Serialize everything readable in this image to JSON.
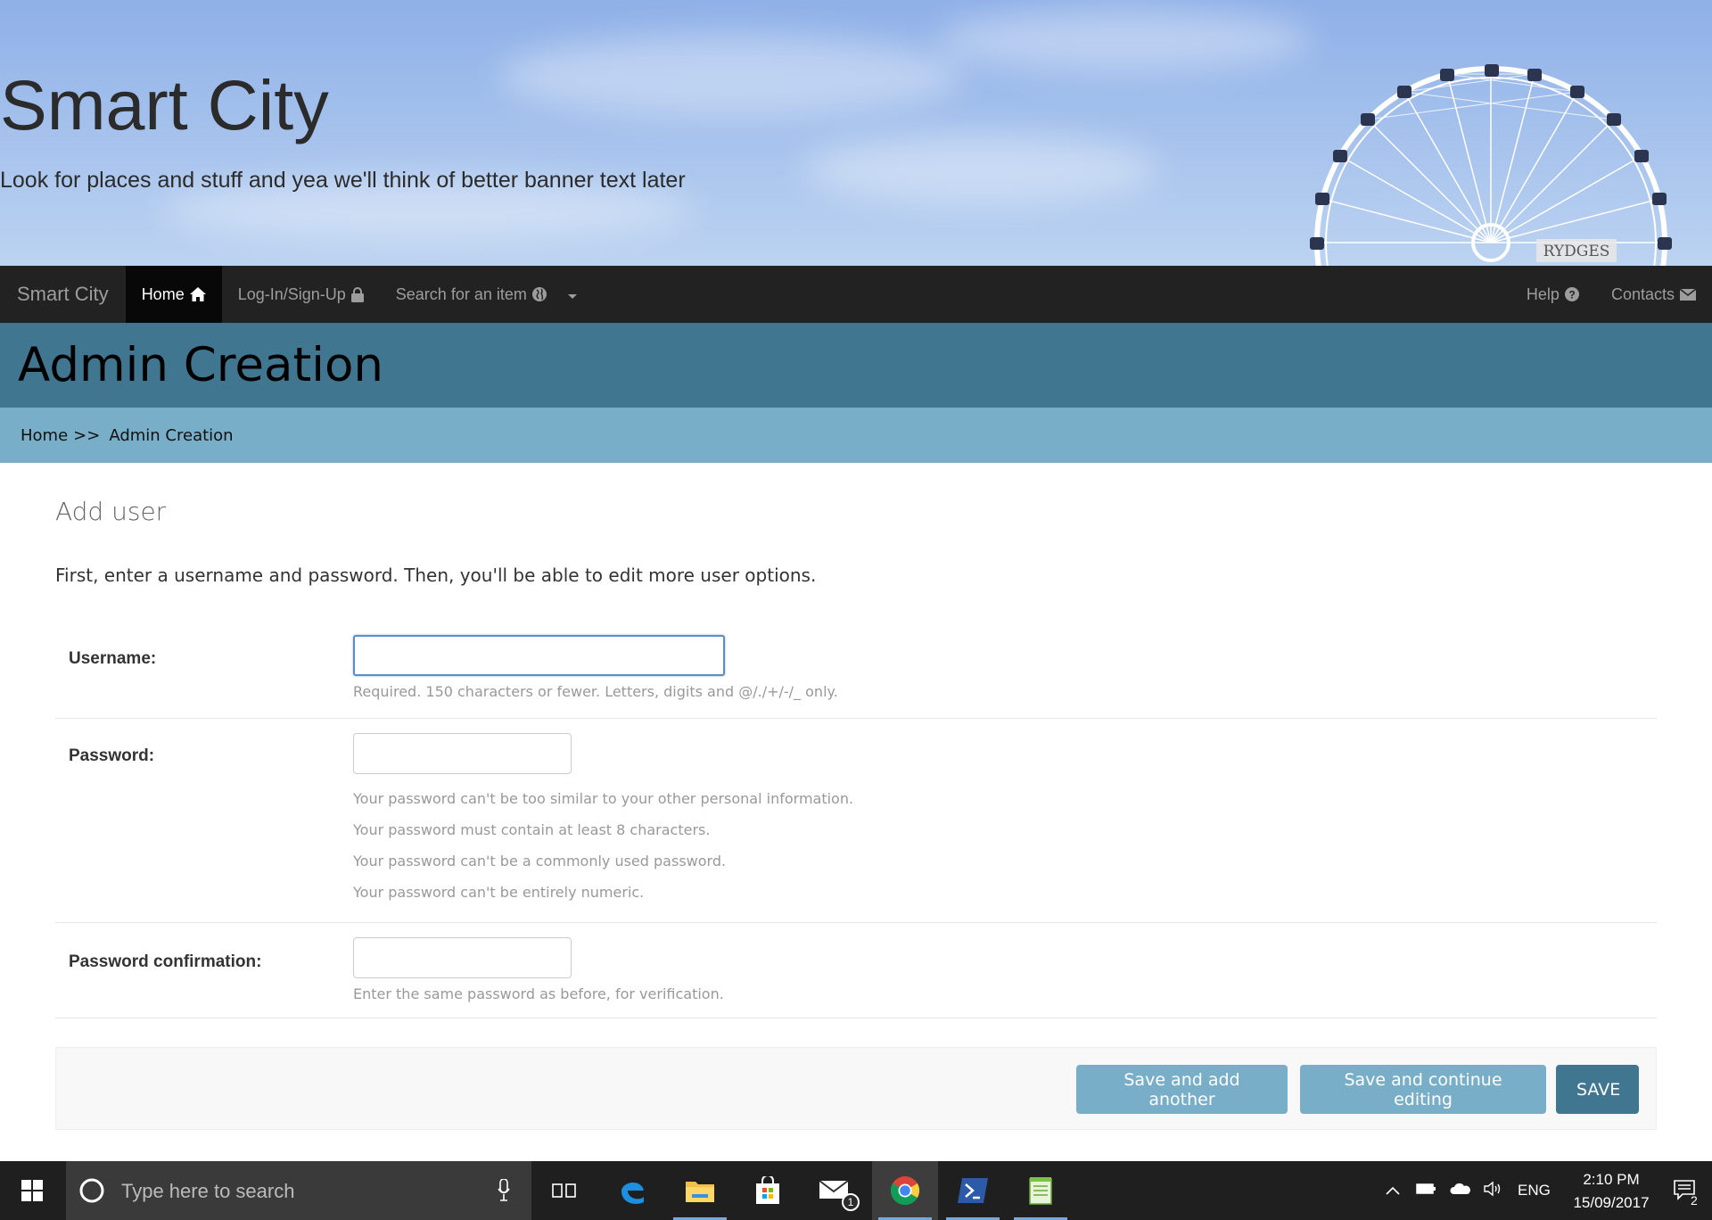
{
  "banner": {
    "title": "Smart City",
    "subtitle": "Look for places and stuff and yea we'll think of better banner text later",
    "wheel_sign": "RYDGES"
  },
  "navbar": {
    "brand": "Smart City",
    "items": [
      {
        "label": "Home",
        "icon": "home-icon",
        "active": true
      },
      {
        "label": "Log-In/Sign-Up",
        "icon": "lock-icon"
      },
      {
        "label": "Search for an item",
        "icon": "globe-icon",
        "dropdown": true
      }
    ],
    "right_items": [
      {
        "label": "Help",
        "icon": "question-circle-icon"
      },
      {
        "label": "Contacts",
        "icon": "envelope-icon"
      }
    ]
  },
  "page_header": {
    "title": "Admin Creation"
  },
  "breadcrumbs": {
    "home": "Home",
    "separator": ">>",
    "current": "Admin Creation"
  },
  "form": {
    "title": "Add user",
    "intro": "First, enter a username and password. Then, you'll be able to edit more user options.",
    "username": {
      "label": "Username:",
      "value": "",
      "help": "Required. 150 characters or fewer. Letters, digits and @/./+/-/_ only."
    },
    "password": {
      "label": "Password:",
      "value": "",
      "help": [
        "Your password can't be too similar to your other personal information.",
        "Your password must contain at least 8 characters.",
        "Your password can't be a commonly used password.",
        "Your password can't be entirely numeric."
      ]
    },
    "password_confirmation": {
      "label": "Password confirmation:",
      "value": "",
      "help": "Enter the same password as before, for verification."
    },
    "buttons": {
      "save_add_another": "Save and add another",
      "save_continue": "Save and continue editing",
      "save": "SAVE"
    }
  },
  "taskbar": {
    "search_placeholder": "Type here to search",
    "apps": [
      "task-view-icon",
      "edge-icon",
      "file-explorer-icon",
      "store-icon",
      "mail-icon",
      "chrome-icon",
      "powershell-icon",
      "notepad-icon"
    ],
    "mail_badge": "1",
    "language": "ENG",
    "time": "2:10 PM",
    "date": "15/09/2017",
    "notification_count": "2"
  },
  "colors": {
    "navbar_bg": "#222222",
    "header_bg": "#417690",
    "breadcrumb_bg": "#79aec8",
    "button_secondary": "#79aec8",
    "button_primary": "#417690"
  }
}
